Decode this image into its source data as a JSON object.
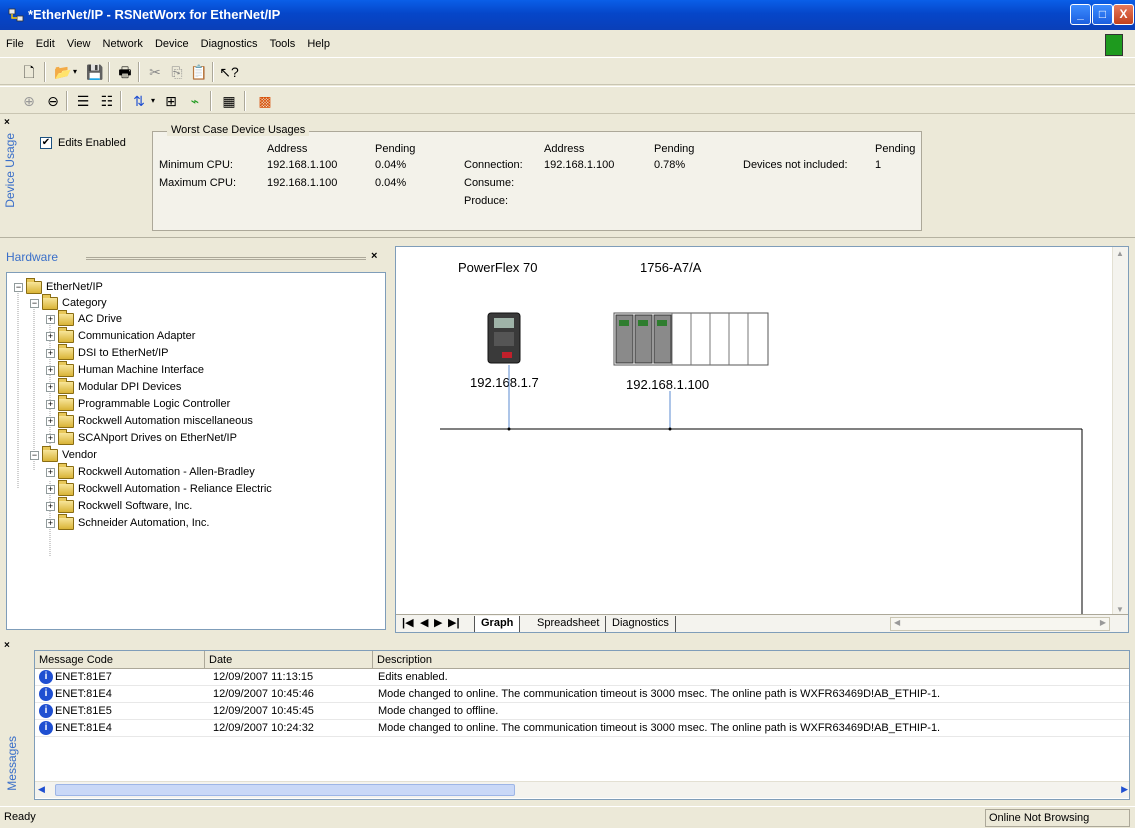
{
  "window": {
    "title": "*EtherNet/IP - RSNetWorx for EtherNet/IP",
    "controls": {
      "minimize": "_",
      "maximize": "□",
      "close": "X"
    }
  },
  "menu": [
    "File",
    "Edit",
    "View",
    "Network",
    "Device",
    "Diagnostics",
    "Tools",
    "Help"
  ],
  "toolbar1_icons": [
    "new-icon",
    "open-icon",
    "save-icon",
    "print-icon",
    "cut-icon",
    "copy-icon",
    "paste-icon",
    "help-pointer-icon"
  ],
  "toolbar2_icons": [
    "zoom-in-icon",
    "zoom-out-icon",
    "single-pass-browse-icon",
    "continuous-browse-icon",
    "upload-icon",
    "download-icon",
    "online-icon",
    "properties-icon",
    "network-config-icon"
  ],
  "usage": {
    "panel_title": "Device Usage",
    "edits_enabled_label": "Edits Enabled",
    "edits_enabled_checked": true,
    "group_title": "Worst Case Device Usages",
    "col_address": "Address",
    "col_pending": "Pending",
    "rows_left": [
      {
        "label": "Minimum CPU:",
        "address": "192.168.1.100",
        "pending": "0.04%"
      },
      {
        "label": "Maximum CPU:",
        "address": "192.168.1.100",
        "pending": "0.04%"
      }
    ],
    "rows_right": [
      {
        "label": "Connection:",
        "address": "192.168.1.100",
        "pending": "0.78%"
      },
      {
        "label": "Consume:"
      },
      {
        "label": "Produce:"
      }
    ],
    "devices_not_included_label": "Devices not included:",
    "devices_not_included_value": "1"
  },
  "hardware": {
    "title": "Hardware",
    "tree": [
      {
        "label": "EtherNet/IP",
        "level": 0,
        "expander": "−"
      },
      {
        "label": "Category",
        "level": 1,
        "expander": "−"
      },
      {
        "label": "AC Drive",
        "level": 2,
        "expander": "+"
      },
      {
        "label": "Communication Adapter",
        "level": 2,
        "expander": "+"
      },
      {
        "label": "DSI to EtherNet/IP",
        "level": 2,
        "expander": "+"
      },
      {
        "label": "Human Machine Interface",
        "level": 2,
        "expander": "+"
      },
      {
        "label": "Modular DPI Devices",
        "level": 2,
        "expander": "+"
      },
      {
        "label": "Programmable Logic Controller",
        "level": 2,
        "expander": "+"
      },
      {
        "label": "Rockwell Automation miscellaneous",
        "level": 2,
        "expander": "+"
      },
      {
        "label": "SCANport Drives on EtherNet/IP",
        "level": 2,
        "expander": "+"
      },
      {
        "label": "Vendor",
        "level": 1,
        "expander": "−"
      },
      {
        "label": "Rockwell Automation - Allen-Bradley",
        "level": 2,
        "expander": "+"
      },
      {
        "label": "Rockwell Automation - Reliance Electric",
        "level": 2,
        "expander": "+"
      },
      {
        "label": "Rockwell Software, Inc.",
        "level": 2,
        "expander": "+"
      },
      {
        "label": "Schneider Automation, Inc.",
        "level": 2,
        "expander": "+"
      }
    ]
  },
  "graph": {
    "devices": [
      {
        "name": "PowerFlex 70",
        "ip": "192.168.1.7"
      },
      {
        "name": "1756-A7/A",
        "ip": "192.168.1.100"
      }
    ],
    "tabs": [
      "Graph",
      "Spreadsheet",
      "Diagnostics"
    ],
    "active_tab": "Graph"
  },
  "messages": {
    "pane_title": "Messages",
    "columns": [
      "Message Code",
      "Date",
      "Description"
    ],
    "rows": [
      {
        "code": "ENET:81E7",
        "date": "12/09/2007 11:13:15",
        "description": "Edits enabled."
      },
      {
        "code": "ENET:81E4",
        "date": "12/09/2007 10:45:46",
        "description": "Mode changed to online. The communication timeout is 3000 msec. The online path is WXFR63469D!AB_ETHIP-1."
      },
      {
        "code": "ENET:81E5",
        "date": "12/09/2007 10:45:45",
        "description": "Mode changed to offline."
      },
      {
        "code": "ENET:81E4",
        "date": "12/09/2007 10:24:32",
        "description": "Mode changed to online. The communication timeout is 3000 msec. The online path is WXFR63469D!AB_ETHIP-1."
      }
    ]
  },
  "status": {
    "left": "Ready",
    "right": "Online Not Browsing"
  },
  "colors": {
    "titlebar": "#0546c9",
    "face": "#ece9d8",
    "vtab_text": "#3a6fc9",
    "info_icon": "#1f4fd1"
  }
}
